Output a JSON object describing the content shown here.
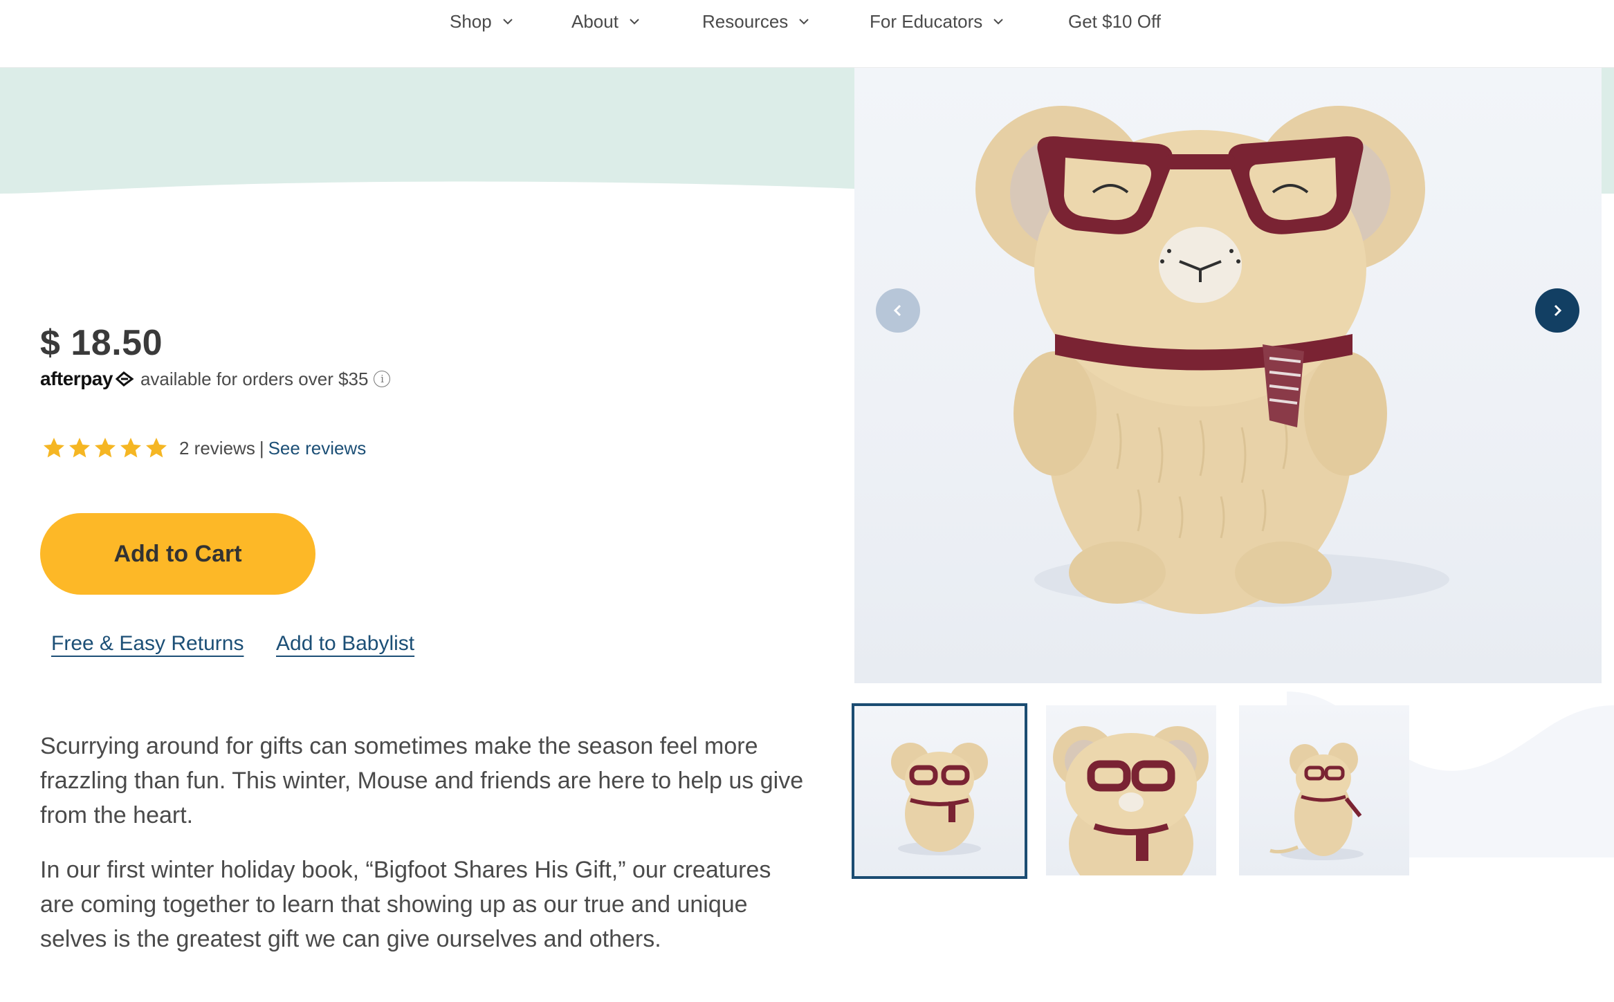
{
  "nav": {
    "items": [
      {
        "label": "Shop",
        "has_dropdown": true
      },
      {
        "label": "About",
        "has_dropdown": true
      },
      {
        "label": "Resources",
        "has_dropdown": true
      },
      {
        "label": "For Educators",
        "has_dropdown": true
      },
      {
        "label": "Get $10 Off",
        "has_dropdown": false
      }
    ]
  },
  "product": {
    "price": "$ 18.50",
    "afterpay": {
      "logo_text": "afterpay",
      "text": "available for orders over $35",
      "info_glyph": "i"
    },
    "rating": {
      "stars": 5,
      "max_stars": 5,
      "count_text": "2 reviews",
      "separator": "|",
      "see_reviews_label": "See reviews"
    },
    "add_to_cart_label": "Add to Cart",
    "links": {
      "returns": "Free & Easy Returns",
      "babylist": "Add to Babylist"
    },
    "description": [
      "Scurrying around for gifts can sometimes make the season feel more frazzling than fun. This winter, Mouse and friends are here to help us give from the heart.",
      "In our first winter holiday book, “Bigfoot Shares His Gift,” our creatures are coming together to learn that showing up as our true and unique selves is the greatest gift we can give ourselves and others."
    ]
  },
  "gallery": {
    "active_index": 0,
    "thumbnail_count": 3,
    "prev_icon": "chevron-left-icon",
    "next_icon": "chevron-right-icon"
  },
  "colors": {
    "accent_yellow": "#fdb827",
    "link_blue": "#1c4f76",
    "mint_band": "#dcede8",
    "arrow_dark": "#123f63",
    "arrow_light": "#b7c6d8",
    "star_gold": "#f5b623"
  }
}
